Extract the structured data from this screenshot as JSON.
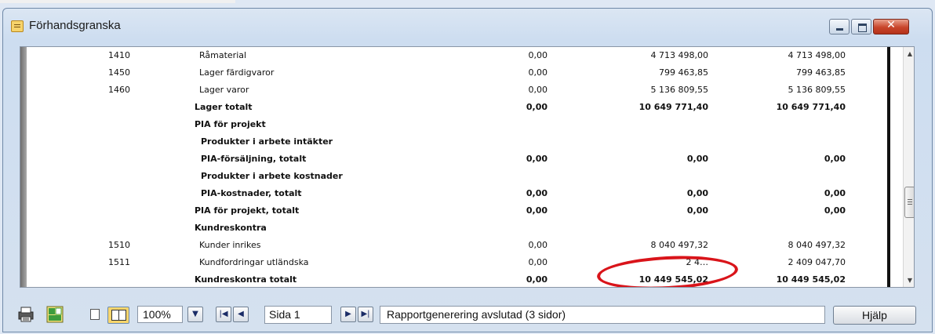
{
  "window": {
    "title": "Förhandsgranska",
    "close_glyph": "✕"
  },
  "report": {
    "rows": [
      {
        "account": "1410",
        "name": "Råmaterial",
        "a": "0,00",
        "b": "4 713 498,00",
        "c": "4 713 498,00",
        "bold": false
      },
      {
        "account": "1450",
        "name": "Lager färdigvaror",
        "a": "0,00",
        "b": "799 463,85",
        "c": "799 463,85",
        "bold": false
      },
      {
        "account": "1460",
        "name": "Lager varor",
        "a": "0,00",
        "b": "5 136 809,55",
        "c": "5 136 809,55",
        "bold": false
      },
      {
        "account": "",
        "name": "Lager totalt",
        "a": "0,00",
        "b": "10 649 771,40",
        "c": "10 649 771,40",
        "bold": true
      },
      {
        "account": "",
        "name": "PIA för projekt",
        "a": "",
        "b": "",
        "c": "",
        "bold": true
      },
      {
        "account": "",
        "name": "Produkter i arbete intäkter",
        "a": "",
        "b": "",
        "c": "",
        "bold": true
      },
      {
        "account": "",
        "name": "PIA-försäljning, totalt",
        "a": "0,00",
        "b": "0,00",
        "c": "0,00",
        "bold": true
      },
      {
        "account": "",
        "name": "Produkter i arbete kostnader",
        "a": "",
        "b": "",
        "c": "",
        "bold": true
      },
      {
        "account": "",
        "name": "PIA-kostnader, totalt",
        "a": "0,00",
        "b": "0,00",
        "c": "0,00",
        "bold": true
      },
      {
        "account": "",
        "name": "PIA för projekt, totalt",
        "a": "0,00",
        "b": "0,00",
        "c": "0,00",
        "bold": true
      },
      {
        "account": "",
        "name": "Kundreskontra",
        "a": "",
        "b": "",
        "c": "",
        "bold": true
      },
      {
        "account": "1510",
        "name": "Kunder inrikes",
        "a": "0,00",
        "b": "8 040 497,32",
        "c": "8 040 497,32",
        "bold": false
      },
      {
        "account": "1511",
        "name": "Kundfordringar utländska",
        "a": "0,00",
        "b": "2 4…",
        "c": "2 409 047,70",
        "bold": false
      },
      {
        "account": "",
        "name": "Kundreskontra totalt",
        "a": "0,00",
        "b": "10 449 545,02",
        "c": "10 449 545,02",
        "bold": true
      }
    ]
  },
  "toolbar": {
    "zoom_value": "100%",
    "page_value": "Sida 1",
    "status_text": "Rapportgenerering avslutad (3 sidor)",
    "help_label": "Hjälp",
    "nav_first_glyph": "|◀",
    "nav_prev_glyph": "◀",
    "nav_next_glyph": "▶",
    "nav_last_glyph": "▶|",
    "dropdown_glyph": "▼"
  },
  "scrollbar": {
    "up_glyph": "▲",
    "down_glyph": "▼"
  },
  "colors": {
    "highlight": "#d9141a",
    "title_bg": "#cdddf0",
    "close_button": "#c8452a"
  },
  "icons": [
    "app-icon",
    "printer-icon",
    "export-icon",
    "single-page-icon",
    "two-pages-icon"
  ]
}
